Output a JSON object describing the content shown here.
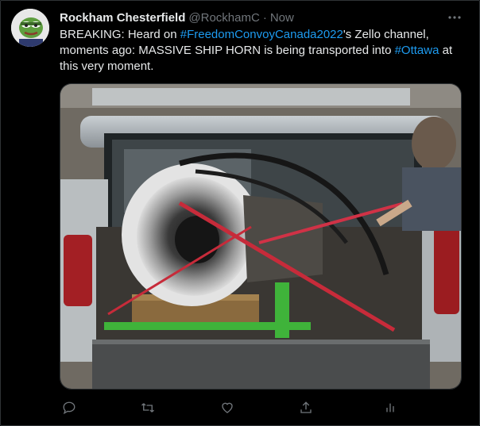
{
  "tweet": {
    "author_name": "Rockham Chesterfield",
    "author_handle": "@RockhamC",
    "separator": "·",
    "timestamp": "Now",
    "text_parts": {
      "p1": "BREAKING: Heard on ",
      "hashtag1": "#FreedomConvoyCanada2022",
      "p2": "'s Zello channel, moments ago: MASSIVE SHIP HORN is being transported into ",
      "hashtag2": "#Ottawa",
      "p3": " at this very moment."
    }
  },
  "icons": {
    "avatar": "pepe-frog-avatar",
    "more": "more-horizontal-icon",
    "reply": "reply-icon",
    "retweet": "retweet-icon",
    "like": "heart-icon",
    "share": "share-icon",
    "analytics": "analytics-icon"
  },
  "colors": {
    "background": "#000000",
    "text": "#e7e9ea",
    "secondary": "#71767b",
    "link": "#1d9bf0"
  }
}
